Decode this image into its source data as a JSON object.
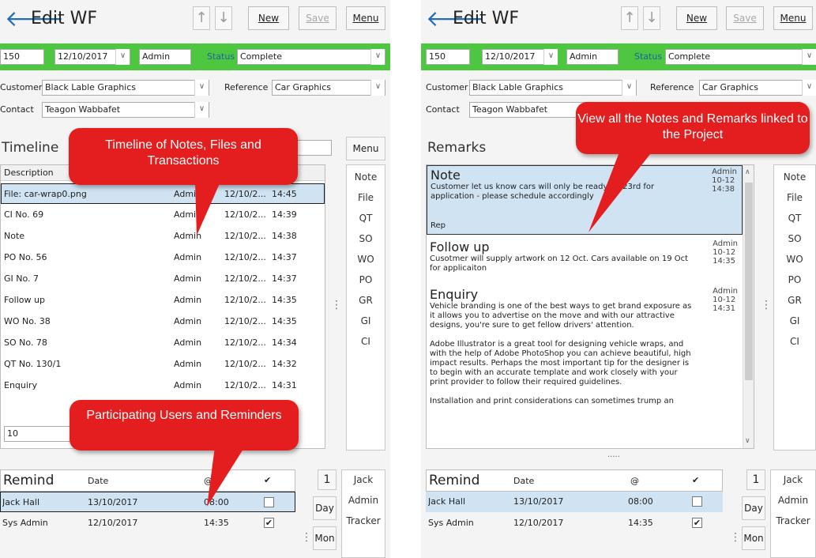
{
  "left": {
    "title": "Edit WF",
    "buttons": {
      "new": "New",
      "save": "Save",
      "menu": "Menu"
    },
    "record": {
      "id": "150",
      "date": "12/10/2017",
      "user": "Admin",
      "status_label": "Status",
      "status": "Complete"
    },
    "customer_label": "Customer",
    "customer": "Black Lable Graphics",
    "reference_label": "Reference",
    "reference": "Car Graphics",
    "contact_label": "Contact",
    "contact": "Teagon Wabbafet",
    "section": "Timeline",
    "section_menu": "Menu",
    "grid_header": "Description",
    "rows": [
      {
        "desc": "File: car-wrap0.png",
        "user": "Admin",
        "date": "12/10/2...",
        "time": "14:45"
      },
      {
        "desc": "CI No. 69",
        "user": "Admin",
        "date": "12/10/2...",
        "time": "14:39"
      },
      {
        "desc": "Note",
        "user": "Admin",
        "date": "12/10/2...",
        "time": "14:38"
      },
      {
        "desc": "PO No. 56",
        "user": "Admin",
        "date": "12/10/2...",
        "time": "14:37"
      },
      {
        "desc": "GI No. 7",
        "user": "Admin",
        "date": "12/10/2...",
        "time": "14:37"
      },
      {
        "desc": "Follow up",
        "user": "Admin",
        "date": "12/10/2...",
        "time": "14:35"
      },
      {
        "desc": "WO No. 38",
        "user": "Admin",
        "date": "12/10/2...",
        "time": "14:35"
      },
      {
        "desc": "SO No. 78",
        "user": "Admin",
        "date": "12/10/2...",
        "time": "14:34"
      },
      {
        "desc": "QT No. 130/1",
        "user": "Admin",
        "date": "12/10/2...",
        "time": "14:32"
      },
      {
        "desc": "Enquiry",
        "user": "Admin",
        "date": "12/10/2...",
        "time": "14:31"
      }
    ],
    "page_size": "10",
    "side": [
      "Note",
      "File",
      "QT",
      "SO",
      "WO",
      "PO",
      "GR",
      "GI",
      "CI"
    ],
    "callout_top": "Timeline of Notes, Files and Transactions",
    "callout_bottom": "Participating Users and Reminders"
  },
  "right": {
    "section": "Remarks",
    "remarks": [
      {
        "title": "Note",
        "text": "Customer let us know cars will only be ready on 23rd for application - please schedule accordingly",
        "footer": "Rep",
        "user": "Admin",
        "date": "10-12",
        "time": "14:38"
      },
      {
        "title": "Follow up",
        "text": "Cusotmer will supply artwork on 12 Oct. Cars available on 19 Oct for applicaiton",
        "user": "Admin",
        "date": "10-12",
        "time": "14:35"
      },
      {
        "title": "Enquiry",
        "text": "Vehicle branding is one of the best ways to get brand exposure as it allows you to advertise on the move and with our attractive designs, you're sure to get fellow drivers' attention.",
        "text2": "Adobe Illustrator is a great tool for designing vehicle wraps, and with the help of Adobe PhotoShop you can achieve beautiful, high impact results. Perhaps the most important tip for the designer is to begin with an accurate template and work closely with your print provider to follow their required guidelines.",
        "text3": "Installation and print considerations can sometimes trump an",
        "user": "Admin",
        "date": "10-12",
        "time": "14:31"
      }
    ],
    "more": ".....",
    "callout": "View all the Notes and Remarks linked to the Project"
  },
  "remind": {
    "title": "Remind",
    "date_header": "Date",
    "at_header": "@",
    "check_header": "✔",
    "rows": [
      {
        "name": "Jack Hall",
        "date": "13/10/2017",
        "time": "08:00",
        "checked": false
      },
      {
        "name": "Sys Admin",
        "date": "12/10/2017",
        "time": "14:35",
        "checked": true
      }
    ],
    "count": "1",
    "users": [
      "Jack",
      "Admin",
      "Tracker"
    ],
    "day": "Day",
    "mon": "Mon"
  },
  "colors": {
    "green": "#4cc73f",
    "accent": "#1f6fb8",
    "callout": "#e41e1e",
    "selected": "#cfe3f3"
  }
}
